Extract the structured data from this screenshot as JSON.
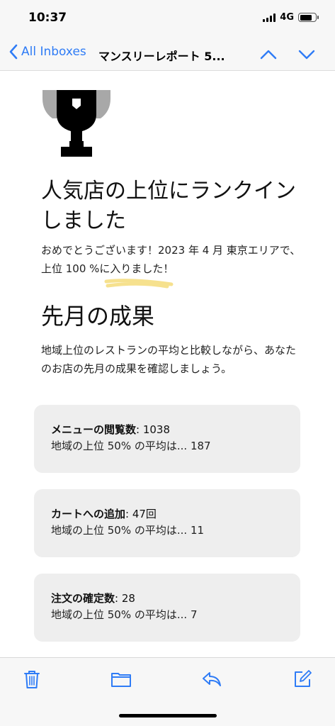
{
  "status_bar": {
    "time": "10:37",
    "network": "4G",
    "battery_level": 0.8
  },
  "nav": {
    "back_label": "All Inboxes",
    "subject": "マンスリーレポート 5...",
    "accent_color": "#2f7cf6"
  },
  "email": {
    "headline": "人気店の上位にランクインしました",
    "intro": "おめでとうございます！2023 年 4 月 東京エリアで、上位 100 %に入りました！",
    "section_title": "先月の成果",
    "section_desc": "地域上位のレストランの平均と比較しながら、あなたのお店の先月の成果を確認しましょう。",
    "stats": [
      {
        "label": "メニューの閲覧数",
        "value": ": 1038",
        "compare": "地域の上位 50% の平均は... 187"
      },
      {
        "label": "カートへの追加",
        "value": ": 47回",
        "compare": "地域の上位 50% の平均は... 11"
      },
      {
        "label": "注文の確定数",
        "value": ": 28",
        "compare": "地域の上位 50% の平均は... 7"
      }
    ]
  },
  "toolbar": {
    "icons": [
      "trash-icon",
      "folder-icon",
      "reply-icon",
      "compose-icon"
    ]
  }
}
